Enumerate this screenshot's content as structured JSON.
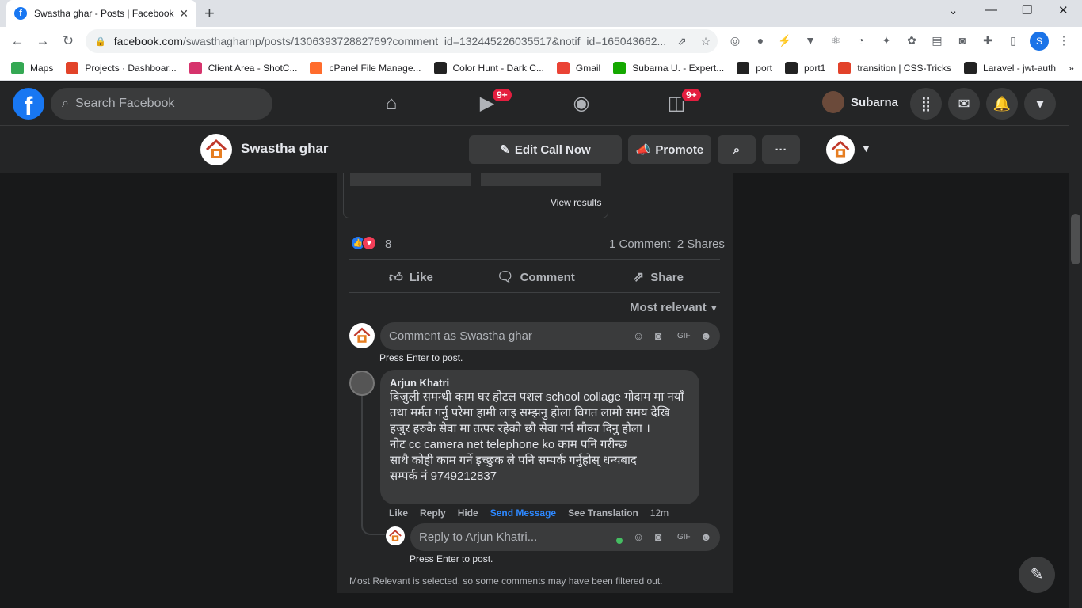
{
  "browser": {
    "tab_title": "Swastha ghar - Posts | Facebook",
    "url_domain": "facebook.com",
    "url_path": "/swasthagharnp/posts/130639372882769?comment_id=132445226035517&notif_id=165043662...",
    "bookmarks": [
      {
        "label": "Maps",
        "color": "#34a853"
      },
      {
        "label": "Projects · Dashboar...",
        "color": "#e24329"
      },
      {
        "label": "Client Area - ShotC...",
        "color": "#d6336c"
      },
      {
        "label": "cPanel File Manage...",
        "color": "#ff6c2c"
      },
      {
        "label": "Color Hunt - Dark C...",
        "color": "#222222"
      },
      {
        "label": "Gmail",
        "color": "#ea4335"
      },
      {
        "label": "Subarna U. - Expert...",
        "color": "#14a800"
      },
      {
        "label": "port",
        "color": "#222222"
      },
      {
        "label": "port1",
        "color": "#222222"
      },
      {
        "label": "transition | CSS-Tricks",
        "color": "#e2422a"
      },
      {
        "label": "Laravel - jwt-auth",
        "color": "#222222"
      }
    ],
    "profile_initial": "S"
  },
  "fb": {
    "search_placeholder": "Search Facebook",
    "video_badge": "9+",
    "gaming_badge": "9+",
    "user_name": "Subarna"
  },
  "page": {
    "name": "Swastha ghar",
    "edit_call": "Edit Call Now",
    "promote": "Promote"
  },
  "post": {
    "view_results": "View results",
    "reaction_count": "8",
    "comments_count": "1 Comment",
    "shares_count": "2 Shares",
    "like": "Like",
    "comment": "Comment",
    "share": "Share",
    "sort": "Most relevant",
    "comment_placeholder": "Comment as Swastha ghar",
    "press_enter": "Press Enter to post.",
    "footnote": "Most Relevant is selected, so some comments may have been filtered out."
  },
  "comment": {
    "author": "Arjun Khatri",
    "text": "बिजुली समन्धी काम घर होटल पशल school collage गोदाम मा नयाँ तथा मर्मत गर्नु परेमा हामी लाइ सम्झनु होला विगत लामो समय देखि हजुर हरुकै सेवा मा तत्पर रहेको छौ सेवा गर्न मौका दिनु होला ।\nनोट cc camera net telephone ko काम पनि गरीन्छ\nसाथै कोही काम गर्ने इच्छुक ले पनि सम्पर्क गर्नुहोस् धन्यबाद\nसम्पर्क नं 9749212837",
    "like": "Like",
    "reply": "Reply",
    "hide": "Hide",
    "send_message": "Send Message",
    "see_translation": "See Translation",
    "time": "12m",
    "reply_placeholder": "Reply to Arjun Khatri...",
    "press_enter": "Press Enter to post."
  }
}
